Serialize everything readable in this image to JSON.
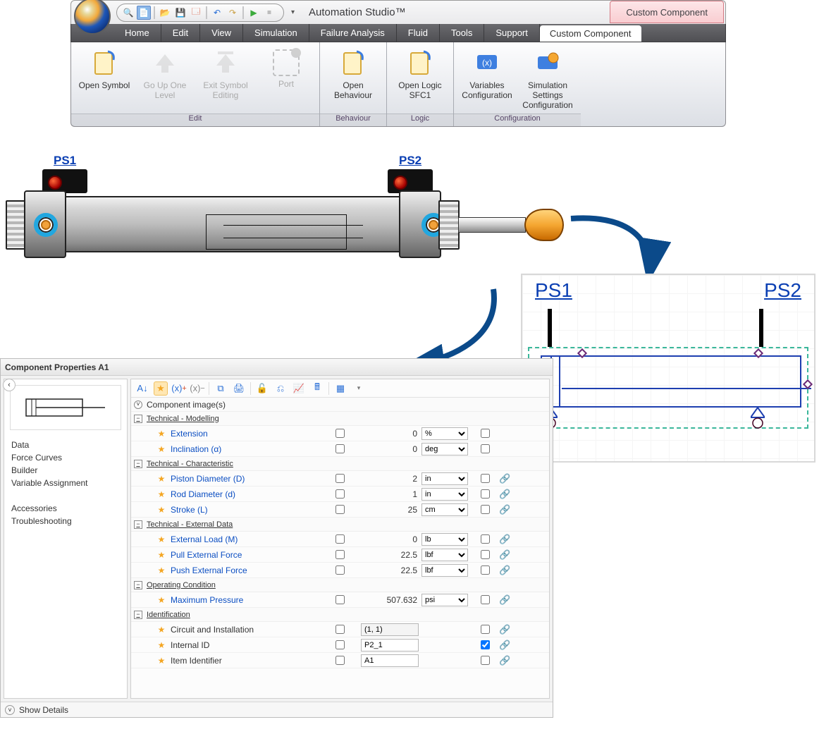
{
  "app_title": "Automation Studio™",
  "custom_tab_top": "Custom Component",
  "menu": [
    "Home",
    "Edit",
    "View",
    "Simulation",
    "Failure Analysis",
    "Fluid",
    "Tools",
    "Support",
    "Custom Component"
  ],
  "ribbon_groups": [
    {
      "label": "Edit",
      "buttons": [
        {
          "label": "Open Symbol",
          "icon": "page-icon",
          "enabled": true
        },
        {
          "label": "Go Up One Level",
          "icon": "arrow-up-icon",
          "enabled": false
        },
        {
          "label": "Exit Symbol Editing",
          "icon": "arrow-up-hat-icon",
          "enabled": false
        },
        {
          "label": "Port",
          "icon": "port-icon",
          "enabled": false
        }
      ]
    },
    {
      "label": "Behaviour",
      "buttons": [
        {
          "label": "Open Behaviour",
          "icon": "page-icon",
          "enabled": true
        }
      ]
    },
    {
      "label": "Logic",
      "buttons": [
        {
          "label": "Open Logic SFC1",
          "icon": "page-icon",
          "enabled": true
        }
      ]
    },
    {
      "label": "Configuration",
      "buttons": [
        {
          "label": "Variables Configuration",
          "icon": "globe-icon",
          "enabled": true
        },
        {
          "label": "Simulation Settings Configuration",
          "icon": "gear-globe-icon",
          "enabled": true
        }
      ]
    }
  ],
  "sensor_labels": {
    "ps1": "PS1",
    "ps2": "PS2"
  },
  "schematic_labels": {
    "ps1": "PS1",
    "ps2": "PS2"
  },
  "props": {
    "title": "Component Properties A1",
    "component_images_label": "Component image(s)",
    "show_details": "Show Details",
    "nav": [
      "Data",
      "Force Curves",
      "Builder",
      "Variable Assignment",
      "",
      "Accessories",
      "Troubleshooting"
    ],
    "sections": [
      {
        "title": "Technical - Modelling",
        "rows": [
          {
            "name": "Extension",
            "value": "0",
            "unit": "%",
            "link": false
          },
          {
            "name": "Inclination (α)",
            "value": "0",
            "unit": "deg",
            "link": false
          }
        ]
      },
      {
        "title": "Technical - Characteristic",
        "rows": [
          {
            "name": "Piston Diameter (D)",
            "value": "2",
            "unit": "in",
            "link": true,
            "linkcolor": "#e08a2a"
          },
          {
            "name": "Rod Diameter (d)",
            "value": "1",
            "unit": "in",
            "link": true,
            "linkcolor": "#e08a2a"
          },
          {
            "name": "Stroke (L)",
            "value": "25",
            "unit": "cm",
            "link": true,
            "linkcolor": "#2a7de1"
          }
        ]
      },
      {
        "title": "Technical - External Data",
        "rows": [
          {
            "name": "External Load (M)",
            "value": "0",
            "unit": "lb",
            "link": true,
            "linkcolor": "#2a7de1"
          },
          {
            "name": "Pull External Force",
            "value": "22.5",
            "unit": "lbf",
            "link": true,
            "linkcolor": "#2a7de1"
          },
          {
            "name": "Push External Force",
            "value": "22.5",
            "unit": "lbf",
            "link": true,
            "linkcolor": "#2a7de1"
          }
        ]
      },
      {
        "title": "Operating Condition",
        "rows": [
          {
            "name": "Maximum Pressure",
            "value": "507.632",
            "unit": "psi",
            "link": true,
            "linkcolor": "#2a7de1"
          }
        ]
      },
      {
        "title": "Identification",
        "rows": [
          {
            "name": "Circuit and Installation",
            "value": "(1, 1)",
            "input": "combo",
            "plain": true,
            "link": true,
            "linkcolor": "#2a7de1"
          },
          {
            "name": "Internal ID",
            "value": "P2_1",
            "input": "text",
            "plain": true,
            "link": true,
            "linkcolor": "#2a7de1",
            "chk2": true
          },
          {
            "name": "Item Identifier",
            "value": "A1",
            "input": "text",
            "plain": true,
            "link": true,
            "linkcolor": "#2a7de1"
          }
        ]
      }
    ]
  }
}
